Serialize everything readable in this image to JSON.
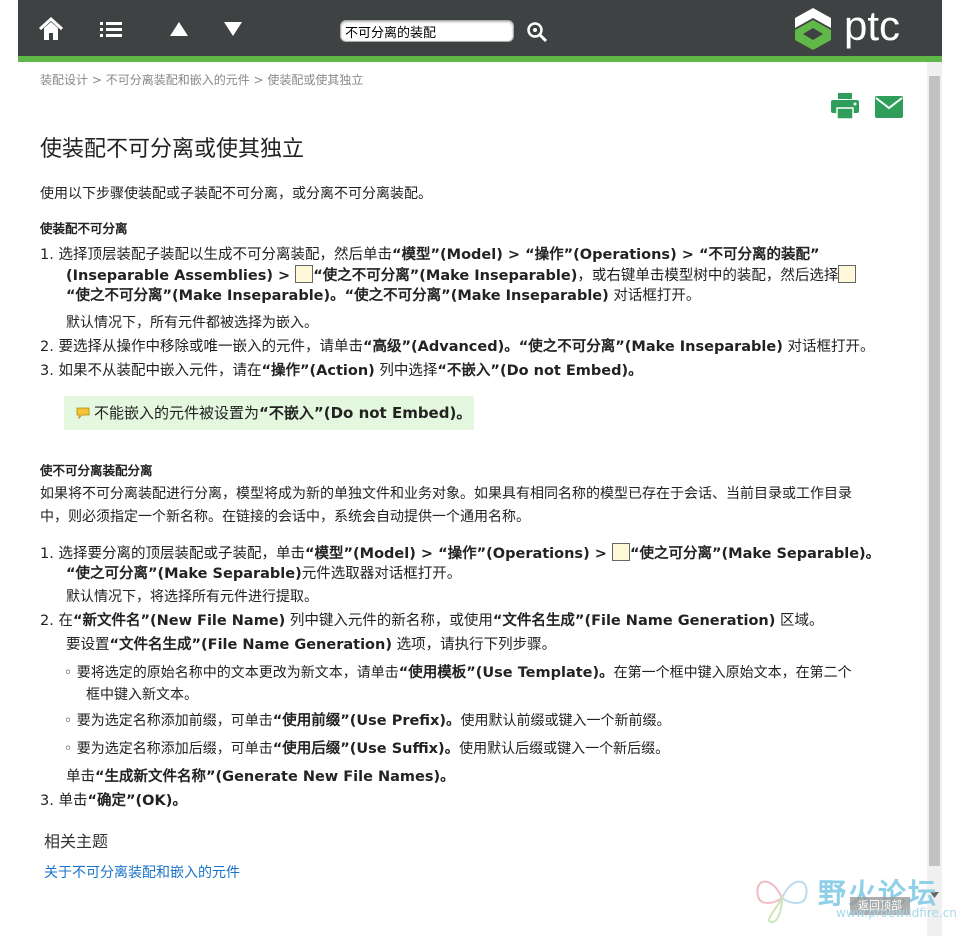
{
  "toolbar": {
    "search_value": "不可分离的装配",
    "logo_text": "ptc",
    "accent_color": "#5fb847",
    "bar_color": "#3f4243"
  },
  "breadcrumb": {
    "items": [
      "装配设计",
      "不可分离装配和嵌入的元件",
      "使装配或使其独立"
    ],
    "separator": " > "
  },
  "page": {
    "title": "使装配不可分离或使其独立",
    "intro": "使用以下步骤使装配或子装配不可分离，或分离不可分离装配。"
  },
  "section1": {
    "heading": "使装配不可分离",
    "step1_a": "1. 选择顶层装配子装配以生成不可分离装配，然后单击",
    "step1_b": "“模型”(Model) > “操作”(Operations) > “不可分离的装配”",
    "step1_c": "(Inseparable Assemblies) > ",
    "step1_d": "“使之不可分离”(Make Inseparable)",
    "step1_e": "，或右键单击模型树中的装配，然后选择",
    "step1_f": "“使之不可分离”(Make Inseparable)。“使之不可分离”(Make Inseparable)",
    "step1_g": " 对话框打开。",
    "step1_note": "默认情况下，所有元件都被选择为嵌入。",
    "step2_a": "2. 要选择从操作中移除或唯一嵌入的元件，请单击",
    "step2_b": "“高级”(Advanced)。“使之不可分离”(Make Inseparable)",
    "step2_c": " 对话框打开。",
    "step3_a": "3. 如果不从装配中嵌入元件，请在",
    "step3_b": "“操作”(Action)",
    "step3_c": " 列中选择",
    "step3_d": "“不嵌入”(Do not Embed)。",
    "note_a": "不能嵌入的元件被设置为",
    "note_b": "“不嵌入”(Do not Embed)。"
  },
  "section2": {
    "heading": "使不可分离装配分离",
    "para_line1": "如果将不可分离装配进行分离，模型将成为新的单独文件和业务对象。如果具有相同名称的模型已存在于会话、当前目录或工作目录",
    "para_line2": "中，则必须指定一个新名称。在链接的会话中，系统会自动提供一个通用名称。",
    "step1_a": "1. 选择要分离的顶层装配或子装配，单击",
    "step1_b": "“模型”(Model) > “操作”(Operations) > ",
    "step1_c": "“使之可分离”(Make Separable)。",
    "step1_d": "“使之可分离”(Make Separable)",
    "step1_e": "元件选取器对话框打开。",
    "step1_note": "默认情况下，将选择所有元件进行提取。",
    "step2_a": "2. 在",
    "step2_b": "“新文件名”(New File Name)",
    "step2_c": " 列中键入元件的新名称，或使用",
    "step2_d": "“文件名生成”(File Name Generation)",
    "step2_e": " 区域。",
    "step2_sub_a": "要设置",
    "step2_sub_b": "“文件名生成”(File Name Generation)",
    "step2_sub_c": " 选项，请执行下列步骤。",
    "bullet1_a": "◦ 要将选定的原始名称中的文本更改为新文本，请单击",
    "bullet1_b": "“使用模板”(Use Template)。",
    "bullet1_c": "在第一个框中键入原始文本，在第二个",
    "bullet1_d": "框中键入新文本。",
    "bullet2_a": "◦ 要为选定名称添加前缀，可单击",
    "bullet2_b": "“使用前缀”(Use Prefix)。",
    "bullet2_c": "使用默认前缀或键入一个新前缀。",
    "bullet3_a": "◦ 要为选定名称添加后缀，可单击",
    "bullet3_b": "“使用后缀”(Use Suffix)。",
    "bullet3_c": "使用默认后缀或键入一个新后缀。",
    "gen_a": "单击",
    "gen_b": "“生成新文件名称”(Generate New File Names)。",
    "step3_a": "3. 单击",
    "step3_b": "“确定”(OK)。"
  },
  "related": {
    "heading": "相关主题",
    "link": "关于不可分离装配和嵌入的元件"
  },
  "watermark": {
    "text": "野火论坛",
    "url": "www.proewildfire.cn",
    "back_to_top": "返回顶部"
  }
}
